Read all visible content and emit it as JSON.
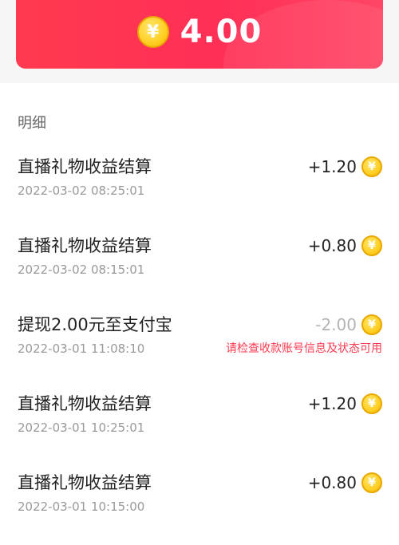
{
  "balance": {
    "coin_symbol": "¥",
    "amount": "4.00"
  },
  "section": {
    "title": "明细"
  },
  "records": [
    {
      "title": "直播礼物收益结算",
      "time": "2022-03-02 08:25:01",
      "amount": "+1.20",
      "coin_symbol": "¥",
      "status": ""
    },
    {
      "title": "直播礼物收益结算",
      "time": "2022-03-02 08:15:01",
      "amount": "+0.80",
      "coin_symbol": "¥",
      "status": ""
    },
    {
      "title": "提现2.00元至支付宝",
      "time": "2022-03-01 11:08:10",
      "amount": "-2.00",
      "coin_symbol": "¥",
      "status": "请检查收款账号信息及状态可用"
    },
    {
      "title": "直播礼物收益结算",
      "time": "2022-03-01 10:25:01",
      "amount": "+1.20",
      "coin_symbol": "¥",
      "status": ""
    },
    {
      "title": "直播礼物收益结算",
      "time": "2022-03-01 10:15:00",
      "amount": "+0.80",
      "coin_symbol": "¥",
      "status": ""
    }
  ],
  "colors": {
    "card_red": "#ff3a4f",
    "coin_gold": "#ffcf24",
    "status_red": "#ff3a4f",
    "negative_gray": "#b3b3b3"
  }
}
